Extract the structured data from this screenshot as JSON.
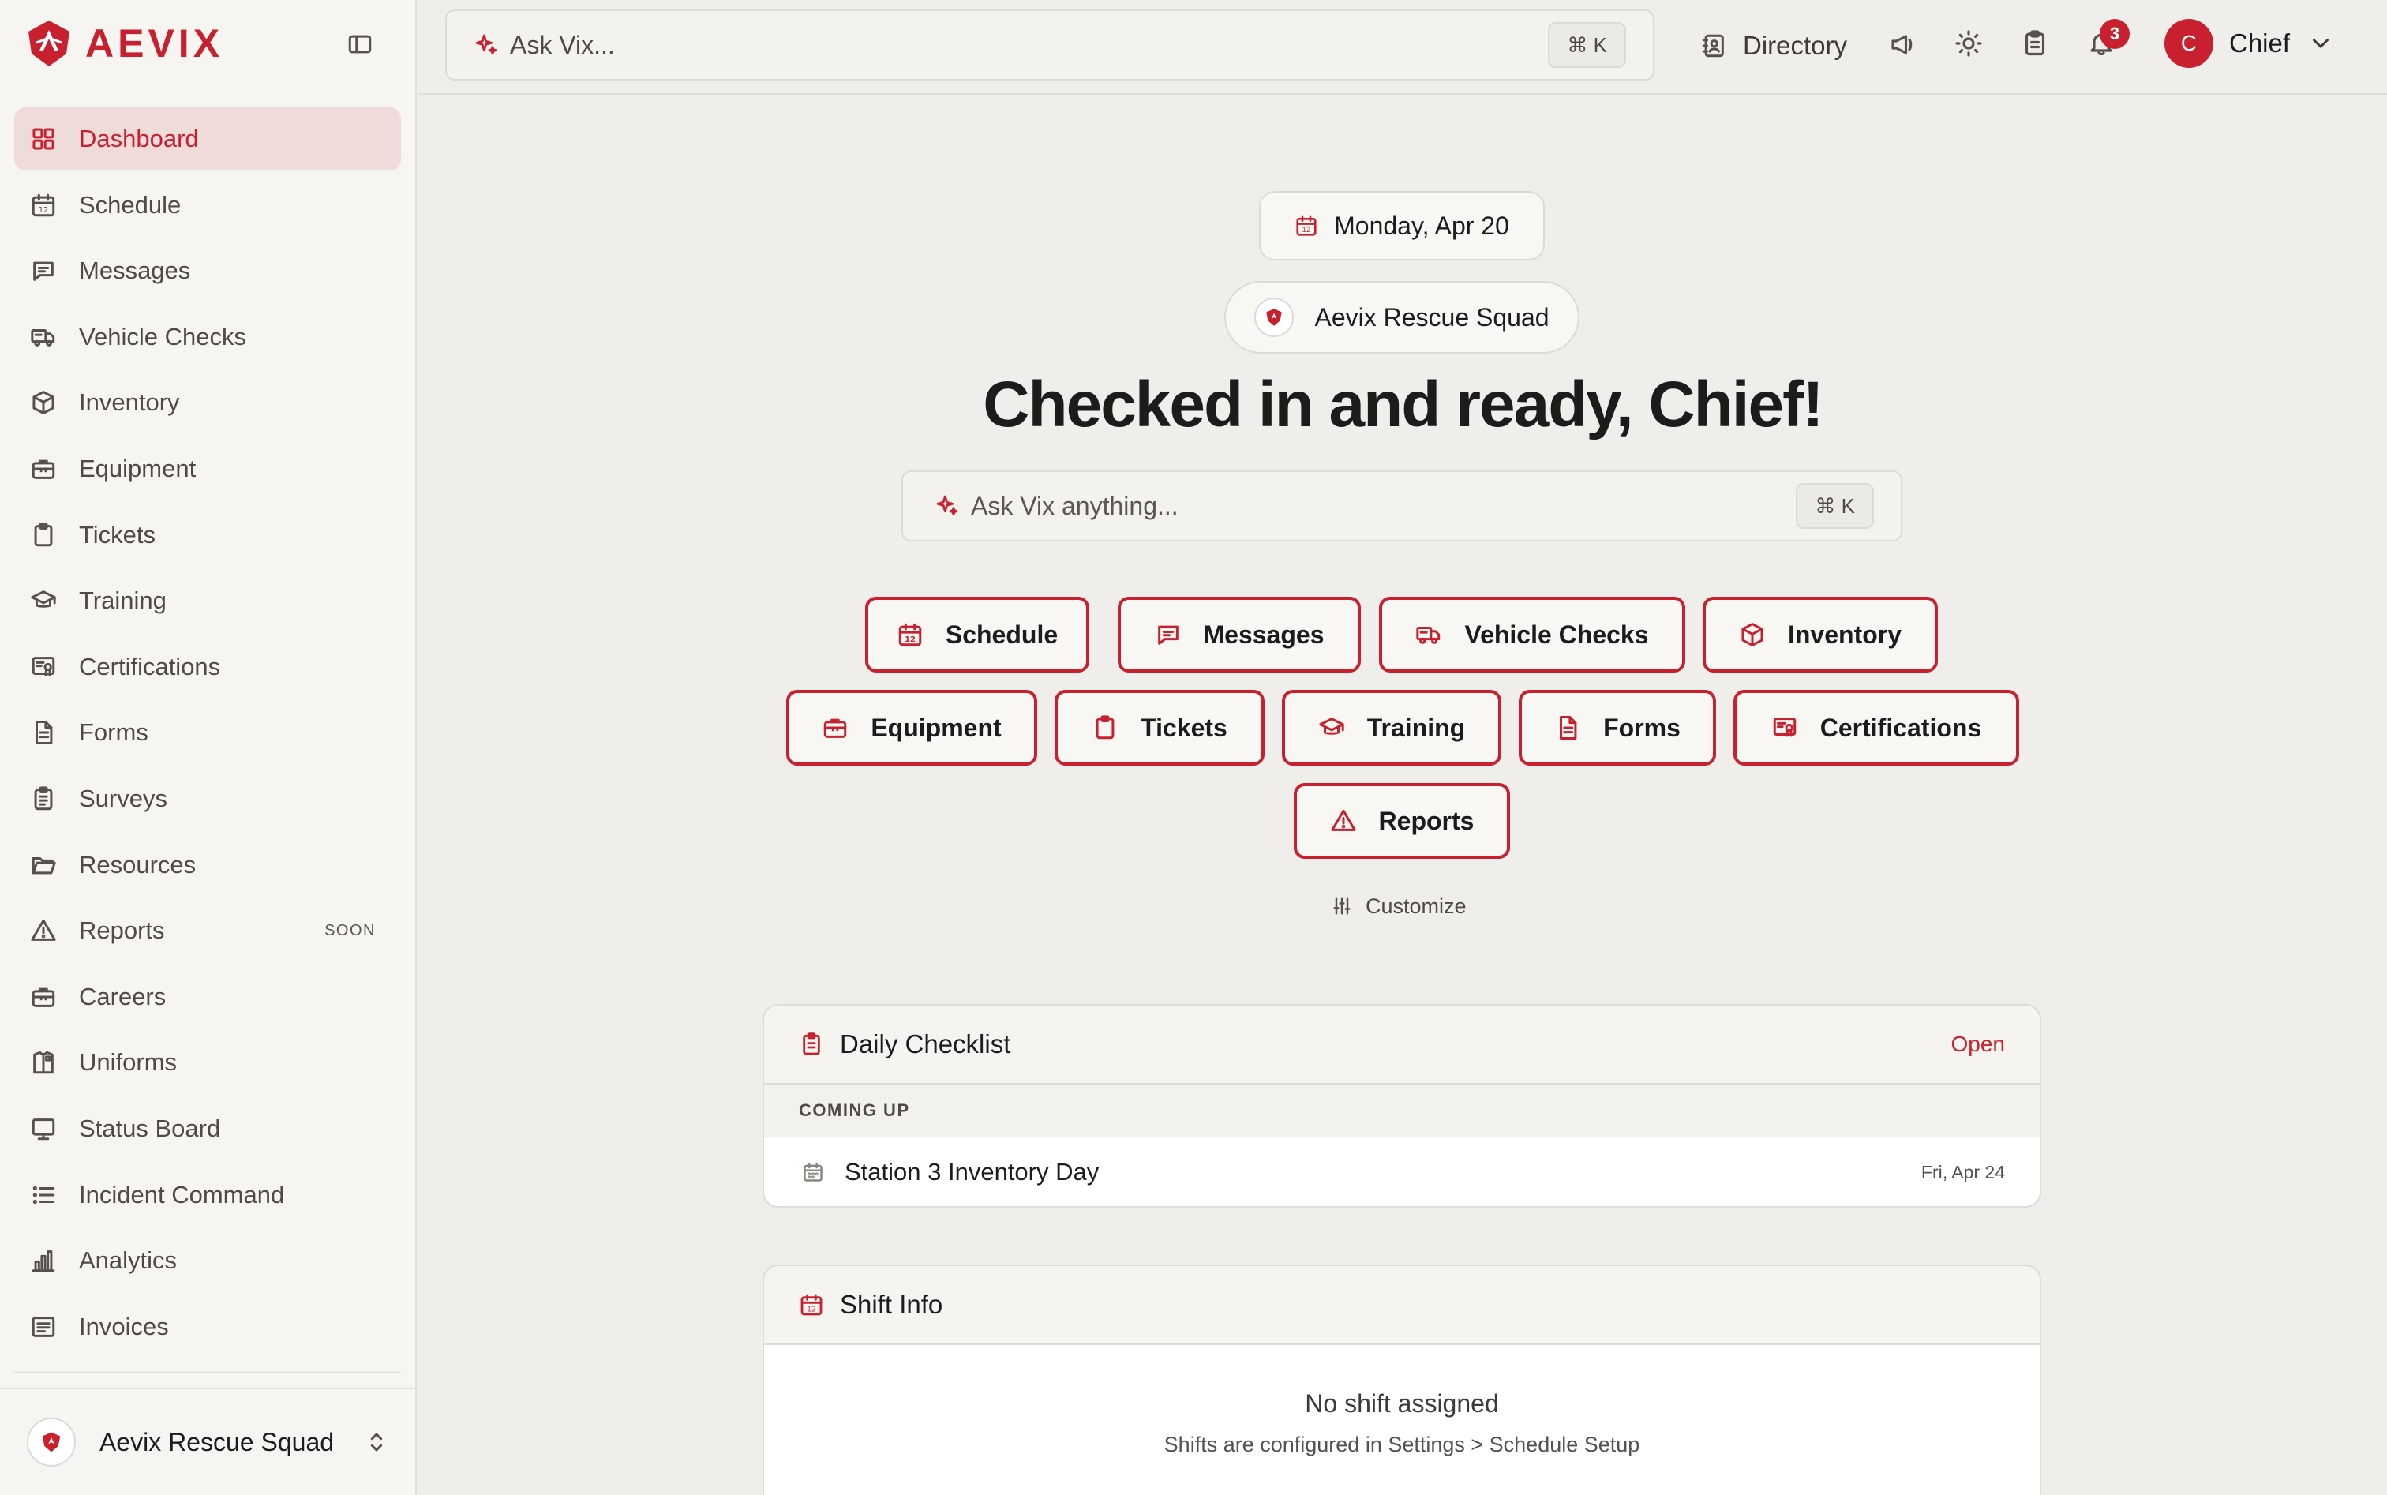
{
  "brand": {
    "name": "AEVIX",
    "accent": "#c8202e"
  },
  "sidebar": {
    "items": [
      {
        "label": "Dashboard",
        "icon": "grid-icon",
        "active": true,
        "badge": ""
      },
      {
        "label": "Schedule",
        "icon": "calendar-icon",
        "badge": ""
      },
      {
        "label": "Messages",
        "icon": "message-icon",
        "badge": ""
      },
      {
        "label": "Vehicle Checks",
        "icon": "truck-icon",
        "badge": ""
      },
      {
        "label": "Inventory",
        "icon": "box-icon",
        "badge": ""
      },
      {
        "label": "Equipment",
        "icon": "briefcase-icon",
        "badge": ""
      },
      {
        "label": "Tickets",
        "icon": "clipboard-icon",
        "badge": ""
      },
      {
        "label": "Training",
        "icon": "graduation-cap-icon",
        "badge": ""
      },
      {
        "label": "Certifications",
        "icon": "certificate-icon",
        "badge": ""
      },
      {
        "label": "Forms",
        "icon": "document-icon",
        "badge": ""
      },
      {
        "label": "Surveys",
        "icon": "clipboard-list-icon",
        "badge": ""
      },
      {
        "label": "Resources",
        "icon": "folder-icon",
        "badge": ""
      },
      {
        "label": "Reports",
        "icon": "warning-icon",
        "badge": "SOON"
      },
      {
        "label": "Careers",
        "icon": "briefcase-icon",
        "badge": ""
      },
      {
        "label": "Uniforms",
        "icon": "shirt-icon",
        "badge": ""
      },
      {
        "label": "Status Board",
        "icon": "monitor-icon",
        "badge": ""
      },
      {
        "label": "Incident Command",
        "icon": "list-icon",
        "badge": ""
      },
      {
        "label": "Analytics",
        "icon": "bar-chart-icon",
        "badge": ""
      },
      {
        "label": "Invoices",
        "icon": "receipt-icon",
        "badge": ""
      }
    ],
    "org_name": "Aevix Rescue Squad"
  },
  "topbar": {
    "search_placeholder": "Ask Vix...",
    "shortcut": "⌘ K",
    "directory_label": "Directory",
    "notification_count": "3",
    "user_initial": "C",
    "user_name": "Chief"
  },
  "main": {
    "date": "Monday, Apr 20",
    "org_name": "Aevix Rescue Squad",
    "greeting": "Checked in and ready, Chief!",
    "search_placeholder": "Ask Vix anything...",
    "shortcut": "⌘ K",
    "quick_actions": [
      {
        "label": "Schedule",
        "icon": "calendar-icon"
      },
      {
        "label": "Messages",
        "icon": "message-icon"
      },
      {
        "label": "Vehicle Checks",
        "icon": "truck-icon"
      },
      {
        "label": "Inventory",
        "icon": "box-icon"
      },
      {
        "label": "Equipment",
        "icon": "briefcase-icon"
      },
      {
        "label": "Tickets",
        "icon": "clipboard-icon"
      },
      {
        "label": "Training",
        "icon": "graduation-cap-icon"
      },
      {
        "label": "Forms",
        "icon": "document-icon"
      },
      {
        "label": "Certifications",
        "icon": "certificate-icon"
      },
      {
        "label": "Reports",
        "icon": "warning-icon"
      }
    ],
    "customize_label": "Customize"
  },
  "daily_checklist": {
    "title": "Daily Checklist",
    "action": "Open",
    "section": "COMING UP",
    "events": [
      {
        "title": "Station 3 Inventory Day",
        "date": "Fri, Apr 24"
      }
    ]
  },
  "shift_info": {
    "title": "Shift Info",
    "empty_title": "No shift assigned",
    "empty_hint": "Shifts are configured in Settings > Schedule Setup"
  }
}
